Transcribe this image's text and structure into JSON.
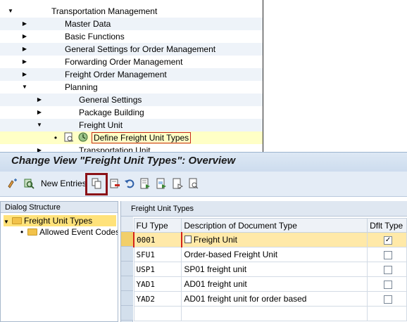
{
  "tree": {
    "items": [
      {
        "label": "Transportation Management",
        "level": 0,
        "expanded": true
      },
      {
        "label": "Master Data",
        "level": 1,
        "expanded": false
      },
      {
        "label": "Basic Functions",
        "level": 1,
        "expanded": false
      },
      {
        "label": "General Settings for Order Management",
        "level": 1,
        "expanded": false
      },
      {
        "label": "Forwarding Order Management",
        "level": 1,
        "expanded": false
      },
      {
        "label": "Freight Order Management",
        "level": 1,
        "expanded": false
      },
      {
        "label": "Planning",
        "level": 1,
        "expanded": true
      },
      {
        "label": "General Settings",
        "level": 2,
        "expanded": false
      },
      {
        "label": "Package Building",
        "level": 2,
        "expanded": false
      },
      {
        "label": "Freight Unit",
        "level": 2,
        "expanded": true
      },
      {
        "label": "Define Freight Unit Types",
        "level": 3,
        "selected": true
      },
      {
        "label": "Transportation Unit",
        "level": 2,
        "expanded": false
      }
    ]
  },
  "window": {
    "title": "Change View \"Freight Unit Types\": Overview"
  },
  "toolbar": {
    "new_entries_label": "New Entries",
    "icons": [
      "display-change-icon",
      "where-used-icon",
      "copy-as-icon",
      "delete-icon",
      "undo-icon",
      "select-all-icon",
      "select-block-icon",
      "deselect-all-icon",
      "variant-icon"
    ]
  },
  "dialog_structure": {
    "header": "Dialog Structure",
    "items": [
      {
        "label": "Freight Unit Types",
        "selected": true
      },
      {
        "label": "Allowed Event Codes",
        "selected": false
      }
    ]
  },
  "table": {
    "header": "Freight Unit Types",
    "columns": [
      "FU Type",
      "Description of Document Type",
      "Dflt Type"
    ],
    "rows": [
      {
        "type": "0001",
        "description": "Freight Unit",
        "default": true
      },
      {
        "type": "SFU1",
        "description": "Order-based Freight Unit",
        "default": false
      },
      {
        "type": "USP1",
        "description": "SP01  freight unit",
        "default": false
      },
      {
        "type": "YAD1",
        "description": "AD01 freight unit",
        "default": false
      },
      {
        "type": "YAD2",
        "description": "AD01 freight unit for order based",
        "default": false
      }
    ]
  },
  "colors": {
    "title_bar": "#cddcee",
    "selection_yellow": "#ffe9a8",
    "highlight_border": "#8b1218"
  }
}
